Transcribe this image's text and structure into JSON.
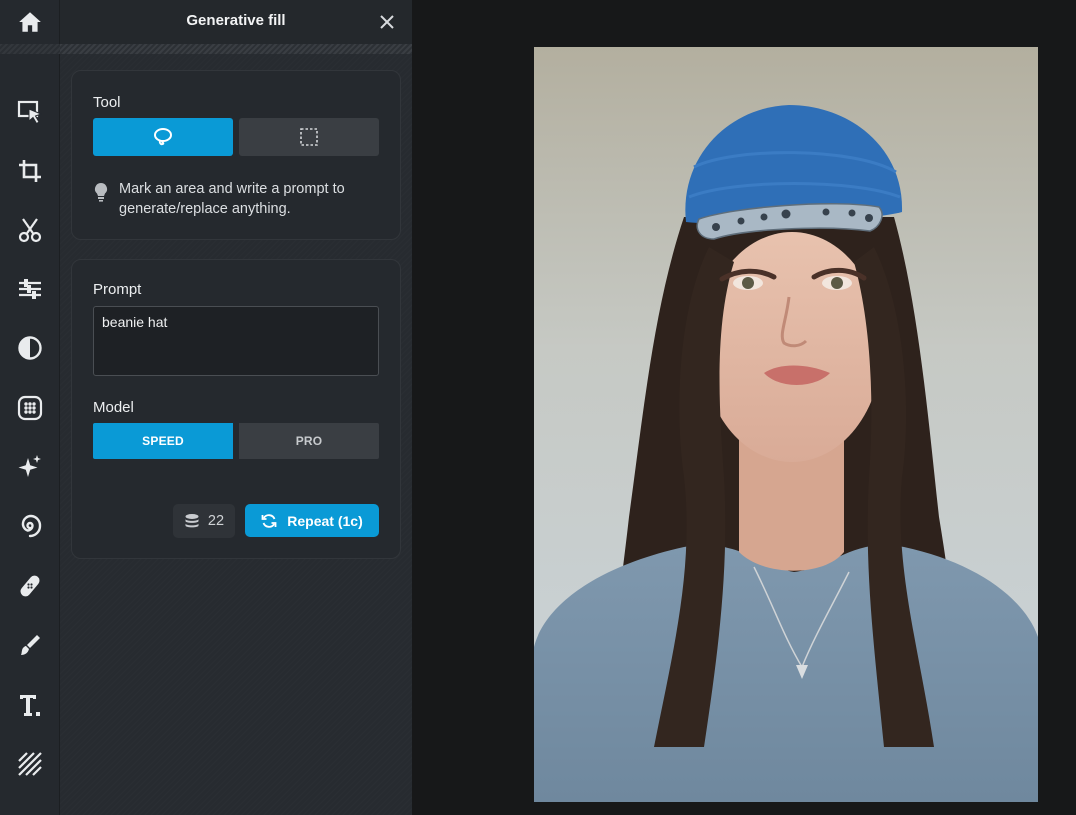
{
  "panel": {
    "title": "Generative fill"
  },
  "tool_section": {
    "label": "Tool",
    "options": [
      "lasso",
      "rectangle"
    ],
    "selected": "lasso",
    "hint": "Mark an area and write a prompt to generate/replace anything."
  },
  "prompt_section": {
    "label": "Prompt",
    "value": "beanie hat"
  },
  "model_section": {
    "label": "Model",
    "options": [
      "SPEED",
      "PRO"
    ],
    "speed_label": "SPEED",
    "pro_label": "PRO",
    "selected": "SPEED"
  },
  "actions": {
    "credits": "22",
    "repeat_label": "Repeat (1c)"
  },
  "rail": {
    "items": [
      "home-icon",
      "select-icon",
      "crop-icon",
      "cut-icon",
      "adjust-icon",
      "contrast-icon",
      "effects-icon",
      "sparkle-icon",
      "swirl-icon",
      "bandage-icon",
      "brush-icon",
      "text-icon",
      "texture-icon"
    ]
  },
  "colors": {
    "accent": "#0a9ad6",
    "panel_bg": "#25292e",
    "canvas_bg": "#171819"
  }
}
